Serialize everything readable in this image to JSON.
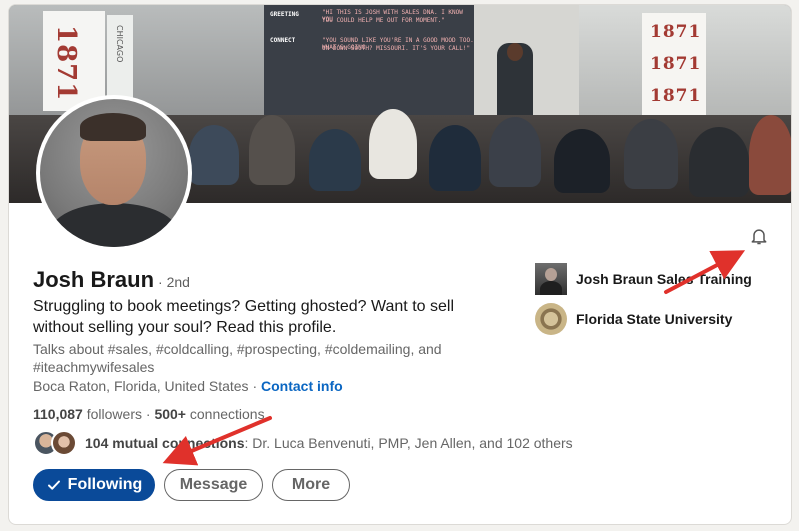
{
  "banner": {
    "screen_lines": [
      "GREETING",
      "CONNECT"
    ],
    "screen_quotes": [
      "\"HI THIS IS JOSH WITH SALES DNA. I KNOW YOU",
      "YOU COULD HELP ME OUT FOR MOMENT.\"",
      "\"YOU SOUND LIKE YOU'RE IN A GOOD MOOD TOO. WHAT'S GOING",
      "ON DOWN SOUTH? MISSOURI. IT'S YOUR CALL!\""
    ],
    "banner_numbers": [
      "1871",
      "1871",
      "1871",
      "1871"
    ],
    "banner_side_text": "CHICAGO",
    "left_banner_numbers": "1871"
  },
  "profile": {
    "name": "Josh Braun",
    "degree": "· 2nd",
    "headline": "Struggling to book meetings? Getting ghosted? Want to sell without selling your soul? Read this profile.",
    "talks_about": "Talks about #sales, #coldcalling, #prospecting, #coldemailing, and #iteachmywifesales",
    "location": "Boca Raton, Florida, United States",
    "location_sep": " · ",
    "contact_info": "Contact info",
    "followers_count": "110,087",
    "followers_label": " followers",
    "stats_sep": "  · ",
    "connections_count": "500+",
    "connections_label": " connections",
    "mutual_count": "104 mutual connections",
    "mutual_rest": ": Dr. Luca Benvenuti, PMP, Jen Allen, and 102 others"
  },
  "actions": {
    "following_label": "Following",
    "message_label": "Message",
    "more_label": "More"
  },
  "sidebar": {
    "company": "Josh Braun Sales Training",
    "education": "Florida State University"
  },
  "icons": {
    "bell": "bell-icon",
    "check": "check-icon"
  },
  "colors": {
    "primary": "#0a4a99",
    "link": "#0a66c2",
    "arrow": "#e0312b"
  }
}
